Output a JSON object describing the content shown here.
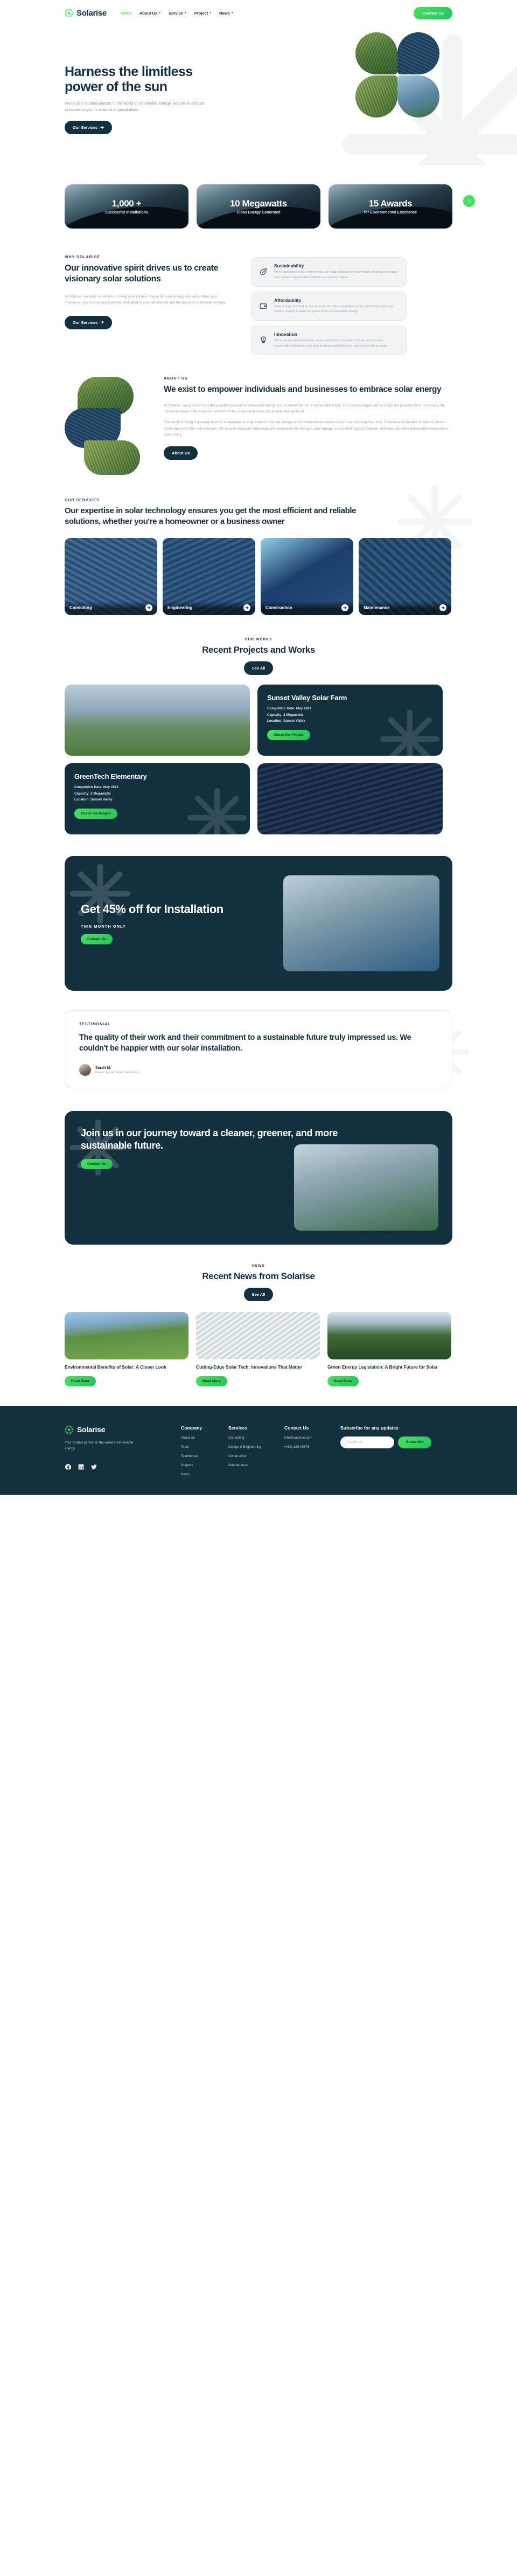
{
  "brand": {
    "name": "Solarise",
    "logo_icon": "sun-burst-icon"
  },
  "header": {
    "nav": [
      {
        "label": "Home",
        "active": true,
        "caret": false
      },
      {
        "label": "About Us",
        "active": false,
        "caret": true
      },
      {
        "label": "Service",
        "active": false,
        "caret": true
      },
      {
        "label": "Project",
        "active": false,
        "caret": true
      },
      {
        "label": "News",
        "active": false,
        "caret": true
      }
    ],
    "contact_label": "Contact Us"
  },
  "hero": {
    "title": "Harness the limitless power of the sun",
    "subtitle": "We're your trusted partner in the world of renewable energy, and we're excited to introduce you to a world of possibilities.",
    "cta": "Our Services"
  },
  "stats": [
    {
      "value": "1,000 +",
      "label": "Successful Installations"
    },
    {
      "value": "10 Megawatts",
      "label": "Clean Energy Generated"
    },
    {
      "value": "15 Awards",
      "label": "for Environmental Excellence"
    }
  ],
  "why": {
    "eyebrow": "WHY SOLARISE",
    "title": "Our innovative spirit drives us to create visionary solar solutions",
    "body": "At Solarise, we pride ourselves on being your premier choice for solar energy solutions. When you choose us, you're choosing a partner dedicated to your satisfaction and the future of sustainable energy.",
    "cta": "Our Services",
    "features": [
      {
        "icon": "leaf-icon",
        "title": "Sustainability",
        "body": "We're committed to the environment. Our solar solutions are eco-friendly, helping you reduce your carbon footprint and contribute to a greener planet."
      },
      {
        "icon": "wallet-icon",
        "title": "Affordability",
        "body": "Solar energy shouldn't be out of reach. We offer competitive pricing and flexible financing options, making it easier for you to switch to renewable energy."
      },
      {
        "icon": "lightbulb-icon",
        "title": "Innovation",
        "body": "We're not just following trends; we're setting them. Solarise is driven by innovation, consistently introducing new solar products and designs to meet your evolving needs."
      }
    ]
  },
  "about": {
    "eyebrow": "ABOUT US",
    "title": "We exist to empower individuals and businesses to embrace solar energy",
    "body1": "At Solarise, we're driven by a deep-rooted passion for renewable energy and a commitment to a sustainable future. Our journey began with a simple but powerful idea: to harness the immense power of the sun and transform it into a source of clean, accessible energy for all.",
    "body2": "The world is facing a growing need for sustainable energy sources. Climate change and environmental concerns are more pressing than ever. Solarise was founded to address these challenges and offer real solutions. We exist to empower individuals and businesses to embrace solar energy, reduce their carbon footprint, and take part inthe global shift toward clean, green living.",
    "cta": "About Us"
  },
  "services": {
    "eyebrow": "OUR SERVICES",
    "title": "Our expertise in solar technology ensures you get the most efficient and reliable solutions, whether you're a homeowner or a business owner",
    "cards": [
      {
        "label": "Consulting",
        "arrow": "arrow-right-icon"
      },
      {
        "label": "Engineering",
        "arrow": "arrow-right-icon"
      },
      {
        "label": "Construction",
        "arrow": "arrow-right-icon"
      },
      {
        "label": "Maintenance",
        "arrow": "arrow-right-icon"
      }
    ]
  },
  "works": {
    "eyebrow": "OUR WORKS",
    "title": "Recent Projects and Works",
    "see_all": "See All",
    "projects": [
      {
        "name": "Sunset Valley Solar Farm",
        "completion": "Completion Date: May 2023",
        "capacity": "Capacity: 2 Megawatts",
        "location": "Location: Sunset Valley",
        "cta": "Check the Project"
      },
      {
        "name": "GreenTech Elementary",
        "completion": "Completion Date: May 2023",
        "capacity": "Capacity: 2 Megawatts",
        "location": "Location: Sunset Valley",
        "cta": "Check the Project"
      }
    ]
  },
  "promo": {
    "title": "Get 45% off for Installation",
    "kicker": "THIS MONTH ONLY",
    "cta": "Contact Us"
  },
  "testimonial": {
    "eyebrow": "TESTIMONIAL",
    "quote": "The quality of their work and their commitment to a sustainable future truly impressed us. We couldn't be happier with our solar installation.",
    "author_name": "Sarah M.",
    "author_role": "Owner Sunset Valley Solar Farm"
  },
  "join": {
    "title": "Join us in our journey toward a cleaner, greener, and more sustainable future.",
    "cta": "Contact Us"
  },
  "news": {
    "eyebrow": "NEWS",
    "title": "Recent News from Solarise",
    "see_all": "See All",
    "articles": [
      {
        "headline": "Environmental Benefits of Solar: A Closer Look",
        "cta": "Read More"
      },
      {
        "headline": "Cutting-Edge Solar Tech: Innovations That Matter",
        "cta": "Read More"
      },
      {
        "headline": "Green Energy Legislation: A Bright Future for Solar",
        "cta": "Read More"
      }
    ]
  },
  "footer": {
    "tagline": "Your trusted partner in the world of renewable energy",
    "social": [
      "facebook-icon",
      "linkedin-icon",
      "twitter-icon"
    ],
    "company": {
      "heading": "Company",
      "items": [
        "About Us",
        "Team",
        "Testimonial",
        "Projects",
        "News"
      ]
    },
    "services": {
      "heading": "Services",
      "items": [
        "Consulting",
        "Design & Engineering",
        "Construction",
        "Maintenance"
      ]
    },
    "contact": {
      "heading": "Contact Us",
      "items": [
        "info@solarise.com",
        "(+62) 1234 5678"
      ]
    },
    "subscribe": {
      "heading": "Subscribe for any updates",
      "placeholder": "Your Email",
      "value": "",
      "button": "Subscribe"
    }
  },
  "colors": {
    "dark": "#12303d",
    "green": "#4ade5e",
    "green_deep": "#22c55e",
    "muted": "#9aa3a8"
  }
}
